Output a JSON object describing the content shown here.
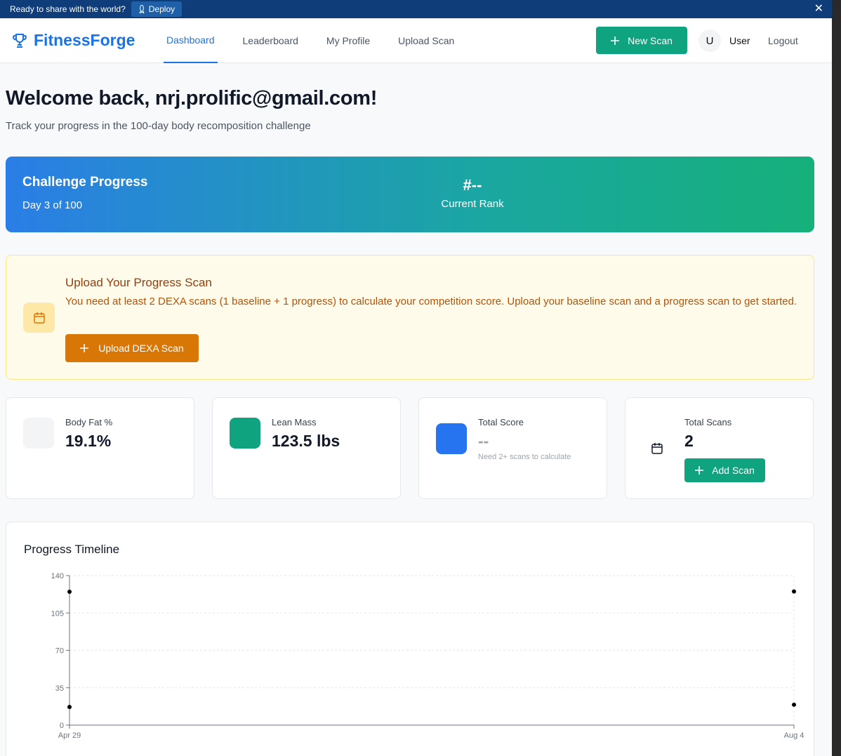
{
  "banner": {
    "message": "Ready to share with the world?",
    "deploy_label": "Deploy",
    "close_glyph": "✕"
  },
  "nav": {
    "brand": "FitnessForge",
    "tabs": [
      "Dashboard",
      "Leaderboard",
      "My Profile",
      "Upload Scan"
    ],
    "active_tab": "Dashboard",
    "new_scan_label": "New Scan",
    "avatar_initial": "U",
    "user_label": "User",
    "logout_label": "Logout"
  },
  "header": {
    "welcome": "Welcome back, nrj.prolific@gmail.com!",
    "subtitle": "Track your progress in the 100-day body recomposition challenge"
  },
  "challenge": {
    "title": "Challenge Progress",
    "day_text": "Day 3 of 100",
    "rank": "#--",
    "rank_label": "Current Rank"
  },
  "upload_notice": {
    "title": "Upload Your Progress Scan",
    "description": "You need at least 2 DEXA scans (1 baseline + 1 progress) to calculate your competition score. Upload your baseline scan and a progress scan to get started.",
    "button_label": "Upload DEXA Scan"
  },
  "stats": {
    "body_fat": {
      "label": "Body Fat %",
      "value": "19.1%",
      "color": "#f3f4f6"
    },
    "lean_mass": {
      "label": "Lean Mass",
      "value": "123.5 lbs",
      "color": "#10a37f"
    },
    "total_score": {
      "label": "Total Score",
      "value": "--",
      "note": "Need 2+ scans to calculate",
      "color": "#2674f0"
    },
    "total_scans": {
      "label": "Total Scans",
      "value": "2",
      "button_label": "Add Scan"
    }
  },
  "timeline": {
    "title": "Progress Timeline"
  },
  "chart_data": {
    "type": "scatter",
    "x": [
      "Apr 29",
      "Aug 4"
    ],
    "series": [
      {
        "values": [
          124.9,
          125.1
        ]
      },
      {
        "values": [
          17,
          19.1
        ]
      }
    ],
    "yticks": [
      0,
      35,
      70,
      105,
      140
    ],
    "ylim": [
      0,
      140
    ],
    "grid": true
  }
}
